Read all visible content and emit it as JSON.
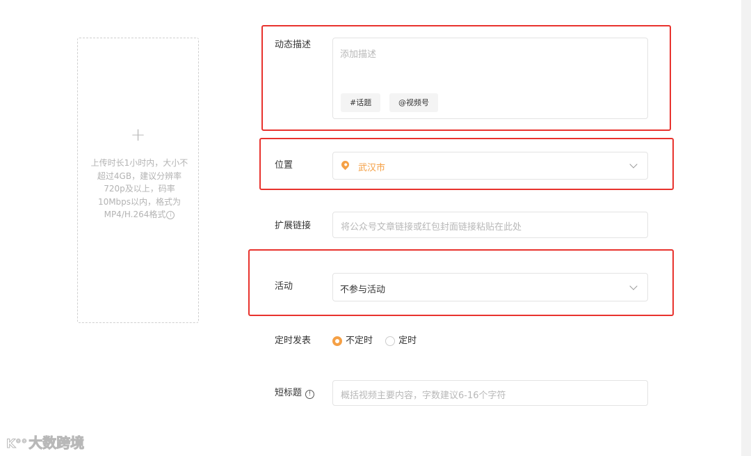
{
  "upload": {
    "plus": "+",
    "hint": "上传时长1小时内，大小不超过4GB，建议分辨率720p及以上，码率10Mbps以内，格式为MP4/H.264格式",
    "info_glyph": "i"
  },
  "form": {
    "description": {
      "label": "动态描述",
      "placeholder": "添加描述",
      "tags": [
        "#话题",
        "@视频号"
      ]
    },
    "location": {
      "label": "位置",
      "value": "武汉市"
    },
    "link": {
      "label": "扩展链接",
      "placeholder": "将公众号文章链接或红包封面链接粘贴在此处"
    },
    "activity": {
      "label": "活动",
      "value": "不参与活动"
    },
    "schedule": {
      "label": "定时发表",
      "options": [
        {
          "label": "不定时",
          "checked": true
        },
        {
          "label": "定时",
          "checked": false
        }
      ]
    },
    "short_title": {
      "label": "短标题",
      "help_glyph": "!",
      "placeholder": "概括视频主要内容，字数建议6-16个字符"
    }
  },
  "watermark": {
    "logo": "K°°",
    "text": "大数跨境"
  },
  "colors": {
    "accent": "#f5a045",
    "highlight": "#e8322d"
  },
  "icons": {
    "location": "map-pin-icon",
    "dropdown": "chevron-down-icon",
    "help": "question-circle-icon"
  }
}
